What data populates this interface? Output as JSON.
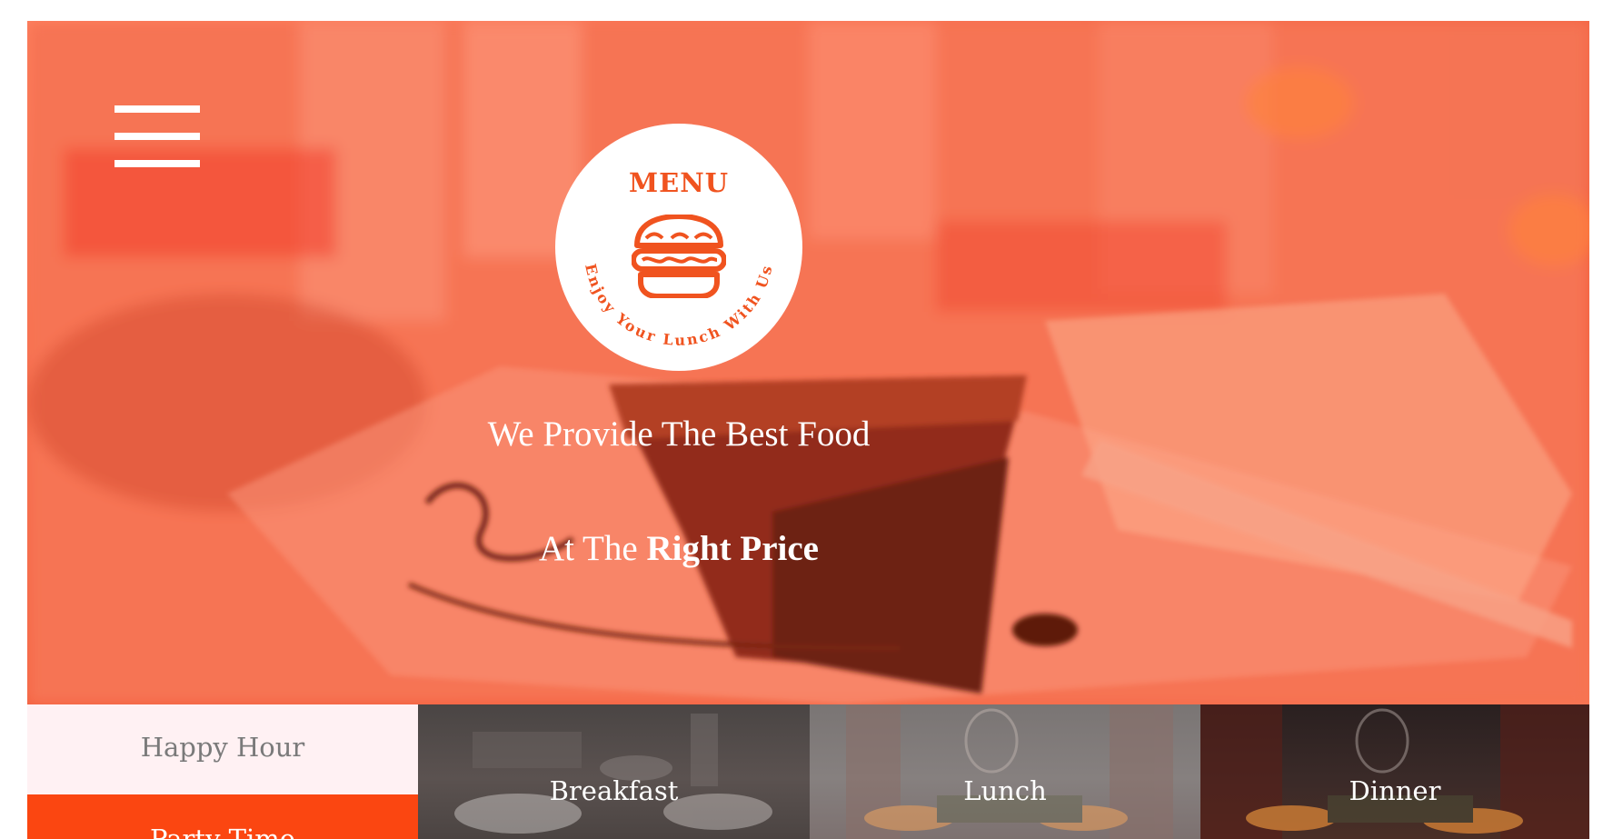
{
  "hero": {
    "logo": {
      "title": "MENU",
      "arc_text": "Enjoy Your Lunch With Us",
      "icon": "burger-icon"
    },
    "tagline_line1": "We Provide The Best Food",
    "tagline_line2_prefix": "At The",
    "tagline_line2_emphasis": "Right Price",
    "menu_toggle_icon": "hamburger-menu-icon"
  },
  "tiles": {
    "happy_hour": "Happy Hour",
    "party_time": "Party Time",
    "breakfast": "Breakfast",
    "lunch": "Lunch",
    "dinner": "Dinner"
  },
  "colors": {
    "accent": "#f0531f",
    "party_bg": "#fb4611",
    "happy_bg": "#fff1f3"
  }
}
